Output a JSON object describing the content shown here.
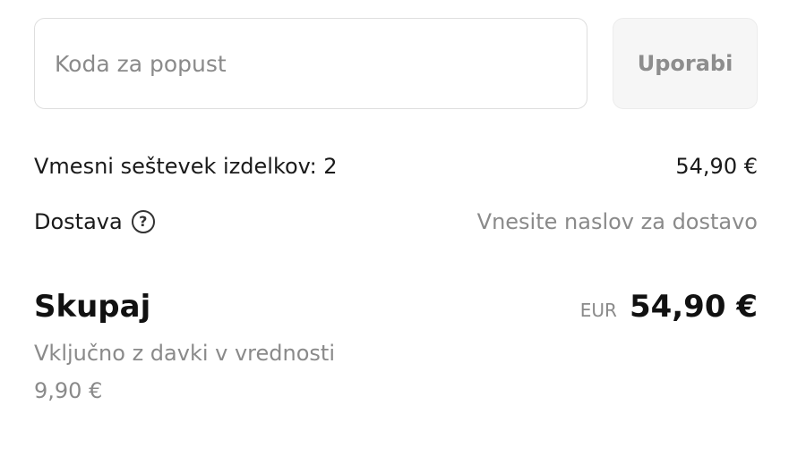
{
  "discount": {
    "placeholder": "Koda za popust",
    "apply_label": "Uporabi"
  },
  "summary": {
    "subtotal_label": "Vmesni seštevek izdelkov: 2",
    "subtotal_value": "54,90 €",
    "shipping_label": "Dostava",
    "shipping_help_icon": "question-circle-icon",
    "shipping_value": "Vnesite naslov za dostavo"
  },
  "total": {
    "label": "Skupaj",
    "currency_code": "EUR",
    "amount": "54,90 €",
    "tax_note_line1": "Vključno z davki v vrednosti",
    "tax_note_line2": "9,90 €"
  }
}
